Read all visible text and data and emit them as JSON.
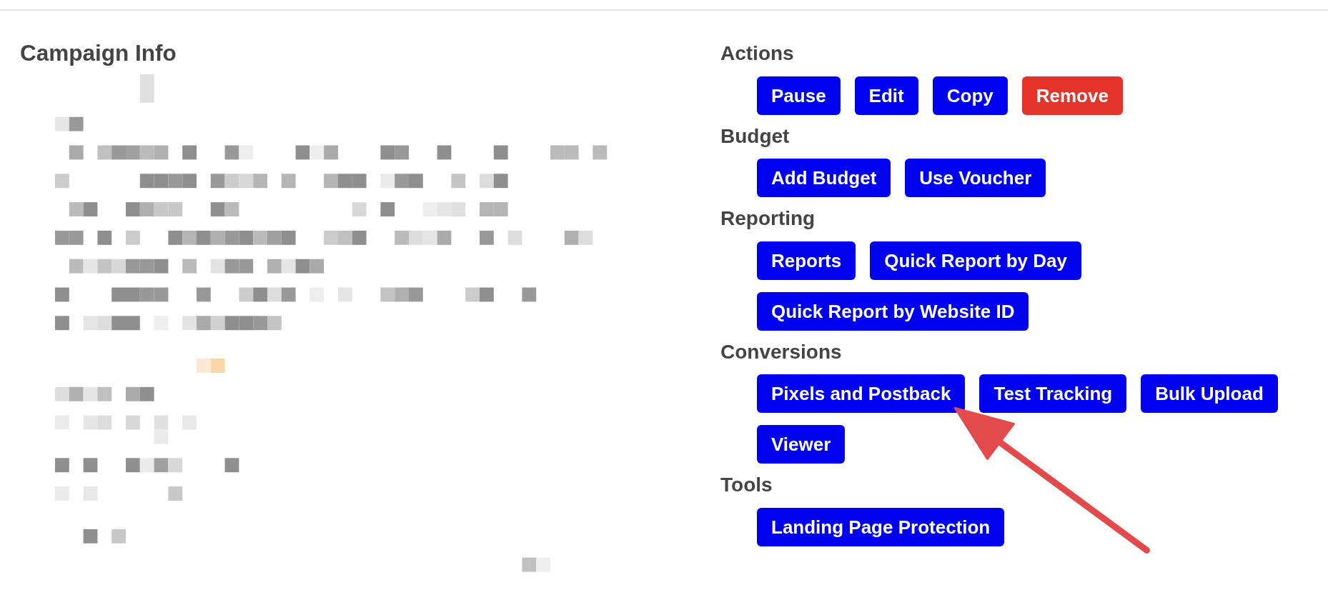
{
  "campaign_info": {
    "title": "Campaign Info",
    "content_pixelated": true
  },
  "sections": [
    {
      "title": "Actions",
      "buttons": [
        {
          "label": "Pause",
          "kind": "primary",
          "annotated": false
        },
        {
          "label": "Edit",
          "kind": "primary",
          "annotated": false
        },
        {
          "label": "Copy",
          "kind": "primary",
          "annotated": false
        },
        {
          "label": "Remove",
          "kind": "danger",
          "annotated": false
        }
      ]
    },
    {
      "title": "Budget",
      "buttons": [
        {
          "label": "Add Budget",
          "kind": "primary",
          "annotated": false
        },
        {
          "label": "Use Voucher",
          "kind": "primary",
          "annotated": false
        }
      ]
    },
    {
      "title": "Reporting",
      "buttons": [
        {
          "label": "Reports",
          "kind": "primary",
          "annotated": false
        },
        {
          "label": "Quick Report by Day",
          "kind": "primary",
          "annotated": false
        },
        {
          "label": "Quick Report by Website ID",
          "kind": "primary",
          "annotated": false
        }
      ]
    },
    {
      "title": "Conversions",
      "buttons": [
        {
          "label": "Pixels and Postback",
          "kind": "primary",
          "annotated": true
        },
        {
          "label": "Test Tracking",
          "kind": "primary",
          "annotated": false
        },
        {
          "label": "Bulk Upload",
          "kind": "primary",
          "annotated": false
        },
        {
          "label": "Viewer",
          "kind": "primary",
          "annotated": false
        }
      ]
    },
    {
      "title": "Tools",
      "buttons": [
        {
          "label": "Landing Page Protection",
          "kind": "primary",
          "annotated": false
        }
      ]
    }
  ]
}
